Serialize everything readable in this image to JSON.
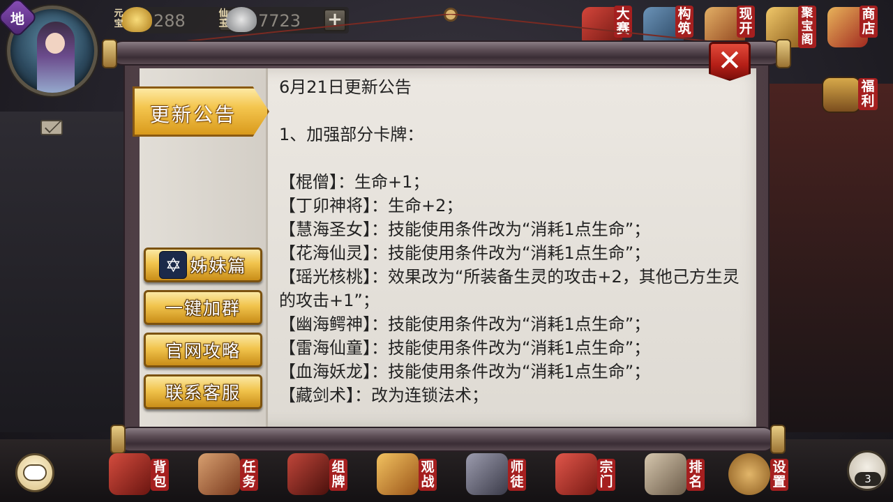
{
  "player": {
    "rank_badge": "地",
    "currencies": [
      {
        "label": "元宝",
        "value": "288",
        "icon": "gold-ingot-icon"
      },
      {
        "label": "仙玉",
        "value": "7723",
        "icon": "jade-stone-icon"
      }
    ]
  },
  "top_menu": [
    {
      "label": "大赛",
      "icon": "crossed-swords-icon",
      "color": "#b52a22"
    },
    {
      "label": "构筑",
      "icon": "deck-build-icon",
      "color": "#4a6a8a"
    },
    {
      "label": "现开",
      "icon": "scroll-open-icon",
      "color": "#b44a24"
    },
    {
      "label": "聚宝阁",
      "icon": "treasure-pavilion-icon",
      "color": "#9a6a2a"
    },
    {
      "label": "商店",
      "icon": "shop-icon",
      "color": "#b8342a"
    }
  ],
  "side_menu": [
    {
      "label": "福利",
      "icon": "treasure-chest-icon"
    }
  ],
  "dialog": {
    "active_tab": "更新公告",
    "buttons": [
      {
        "label": "姊妹篇",
        "icon": "star-of-david-icon"
      },
      {
        "label": "一键加群"
      },
      {
        "label": "官网攻略"
      },
      {
        "label": "联系客服"
      }
    ],
    "close_label": "✕",
    "notice": {
      "title": "6月21日更新公告",
      "section": "1、加强部分卡牌：",
      "lines": [
        "【棍僧】：生命+1；",
        "【丁卯神将】：生命+2；",
        "【慧海圣女】：技能使用条件改为“消耗1点生命”；",
        "【花海仙灵】：技能使用条件改为“消耗1点生命”；",
        "【瑶光核桃】：效果改为“所装备生灵的攻击+2，其他己方生灵的攻击+1”；",
        "【幽海鳄神】：技能使用条件改为“消耗1点生命”；",
        "【雷海仙童】：技能使用条件改为“消耗1点生命”；",
        "【血海妖龙】：技能使用条件改为“消耗1点生命”；",
        "【藏剑术】：改为连锁法术；"
      ]
    }
  },
  "bottom_menu": [
    {
      "label": "背包",
      "icon": "bag-icon",
      "color": "#b8342a"
    },
    {
      "label": "任务",
      "icon": "task-book-icon",
      "color": "#a0603a"
    },
    {
      "label": "组牌",
      "icon": "card-deck-icon",
      "color": "#8a2a24"
    },
    {
      "label": "观战",
      "icon": "eye-lantern-icon",
      "color": "#c8842a"
    },
    {
      "label": "师徒",
      "icon": "master-disciple-icon",
      "color": "#5a5a6a"
    },
    {
      "label": "宗门",
      "icon": "sect-gate-icon",
      "color": "#b8342a"
    },
    {
      "label": "排名",
      "icon": "ranking-scroll-icon",
      "color": "#7a6a5a"
    },
    {
      "label": "设置",
      "icon": "gear-icon",
      "color": "#a87a3a"
    }
  ],
  "friends": {
    "count": "3",
    "icon": "friends-icon"
  },
  "chat": {
    "icon": "chat-bubble-icon"
  }
}
